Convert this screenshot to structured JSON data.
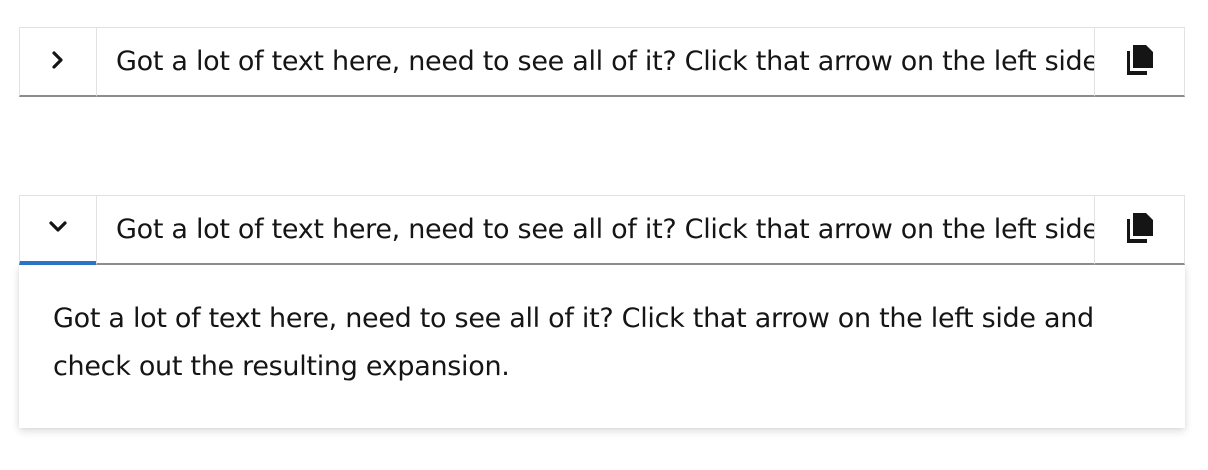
{
  "collapsed": {
    "toggle_icon": "angle-right-icon",
    "text": "Got a lot of text here, need to see all of it? Click that arrow on the left side and check out the resulting expansion.",
    "copy_icon": "copy-icon"
  },
  "expanded": {
    "toggle_icon": "angle-down-icon",
    "text": "Got a lot of text here, need to see all of it? Click that arrow on the left side and check out the resulting expansion.",
    "copy_icon": "copy-icon",
    "expansion_text": "Got a lot of text here, need to see all of it? Click that arrow on the left side and check out the resulting expansion."
  },
  "colors": {
    "active_accent": "#2b73c4",
    "border": "#8a8d90",
    "text": "#151515"
  }
}
